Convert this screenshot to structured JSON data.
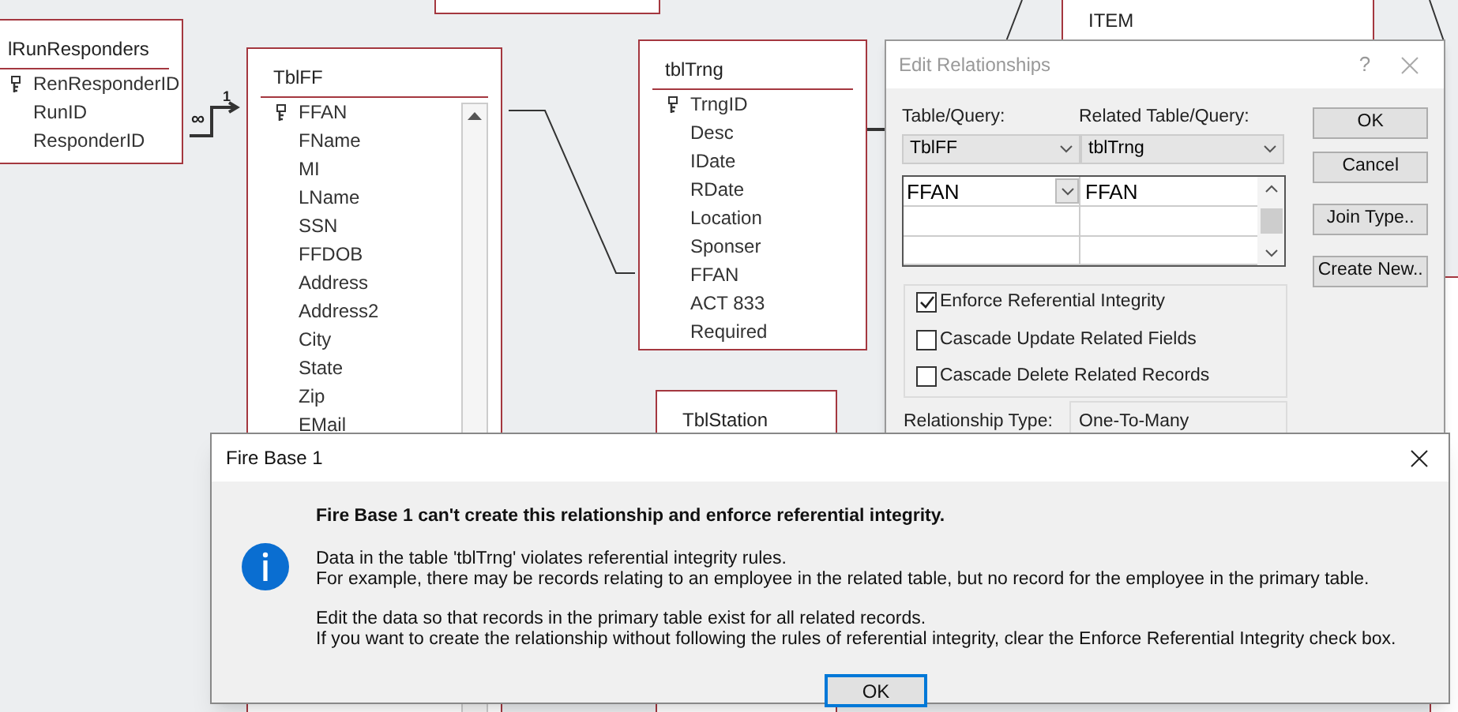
{
  "tables": [
    {
      "title": "lRunResponders",
      "fields": [
        {
          "name": "RenResponderID",
          "primary_key": true
        },
        {
          "name": "RunID",
          "primary_key": false
        },
        {
          "name": "ResponderID",
          "primary_key": false
        }
      ]
    },
    {
      "title": "TblFF",
      "fields": [
        {
          "name": "FFAN",
          "primary_key": true
        },
        {
          "name": "FName",
          "primary_key": false
        },
        {
          "name": "MI",
          "primary_key": false
        },
        {
          "name": "LName",
          "primary_key": false
        },
        {
          "name": "SSN",
          "primary_key": false
        },
        {
          "name": "FFDOB",
          "primary_key": false
        },
        {
          "name": "Address",
          "primary_key": false
        },
        {
          "name": "Address2",
          "primary_key": false
        },
        {
          "name": "City",
          "primary_key": false
        },
        {
          "name": "State",
          "primary_key": false
        },
        {
          "name": "Zip",
          "primary_key": false
        },
        {
          "name": "EMail",
          "primary_key": false
        }
      ]
    },
    {
      "title": "tblTrng",
      "fields": [
        {
          "name": "TrngID",
          "primary_key": true
        },
        {
          "name": "Desc",
          "primary_key": false
        },
        {
          "name": "IDate",
          "primary_key": false
        },
        {
          "name": "RDate",
          "primary_key": false
        },
        {
          "name": "Location",
          "primary_key": false
        },
        {
          "name": "Sponser",
          "primary_key": false
        },
        {
          "name": "FFAN",
          "primary_key": false
        },
        {
          "name": "ACT 833",
          "primary_key": false
        },
        {
          "name": "Required",
          "primary_key": false
        }
      ]
    },
    {
      "title": "TblStation"
    },
    {
      "title": "ITEM"
    }
  ],
  "relationship": {
    "one_label": "1",
    "many_label": "∞"
  },
  "edit_relationships": {
    "title": "Edit Relationships",
    "help": "?",
    "table_label": "Table/Query:",
    "related_label": "Related Table/Query:",
    "table": "TblFF",
    "related_table": "tblTrng",
    "field_rows": [
      {
        "field": "FFAN",
        "related_field": "FFAN"
      }
    ],
    "options": [
      {
        "label": "Enforce Referential Integrity",
        "checked": true
      },
      {
        "label": "Cascade Update Related Fields",
        "checked": false
      },
      {
        "label": "Cascade Delete Related Records",
        "checked": false
      }
    ],
    "relationship_type_label": "Relationship Type:",
    "relationship_type": "One-To-Many",
    "buttons": [
      "OK",
      "Cancel",
      "Join Type..",
      "Create New.."
    ]
  },
  "message_box": {
    "title": "Fire Base 1",
    "heading": "Fire Base 1 can't create this relationship and enforce referential integrity.",
    "paragraphs": [
      [
        "Data in the table 'tblTrng' violates referential integrity rules.",
        "For example, there may be records relating to an employee in the related table, but no record for the employee in the primary table."
      ],
      [
        "Edit the data so that records in the primary table exist for all related records.",
        "If you want to create the relationship without following the rules of referential integrity, clear the Enforce Referential Integrity check box."
      ]
    ],
    "button": "OK"
  }
}
